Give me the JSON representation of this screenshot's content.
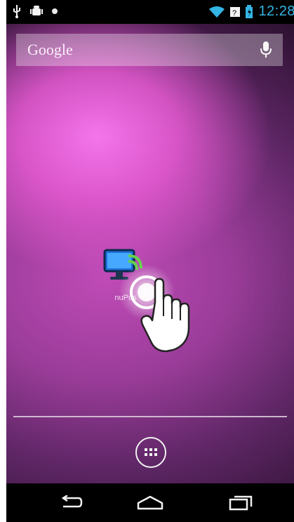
{
  "status_bar": {
    "left_icons": [
      "usb-icon",
      "android-debug-icon",
      "notification-dot-icon"
    ],
    "right_icons": [
      "wifi-icon",
      "signal-icon",
      "battery-icon"
    ],
    "time": "12:28"
  },
  "search": {
    "logo_text": "Google",
    "mic_icon": "mic-icon"
  },
  "home": {
    "app_label": "nuPus"
  },
  "nav": {
    "back_icon": "back-icon",
    "home_icon": "home-icon",
    "recents_icon": "recents-icon"
  },
  "colors": {
    "status_accent": "#33b5e5",
    "wallpaper_highlight": "#f07ee8",
    "wallpaper_dark": "#2d1231"
  }
}
